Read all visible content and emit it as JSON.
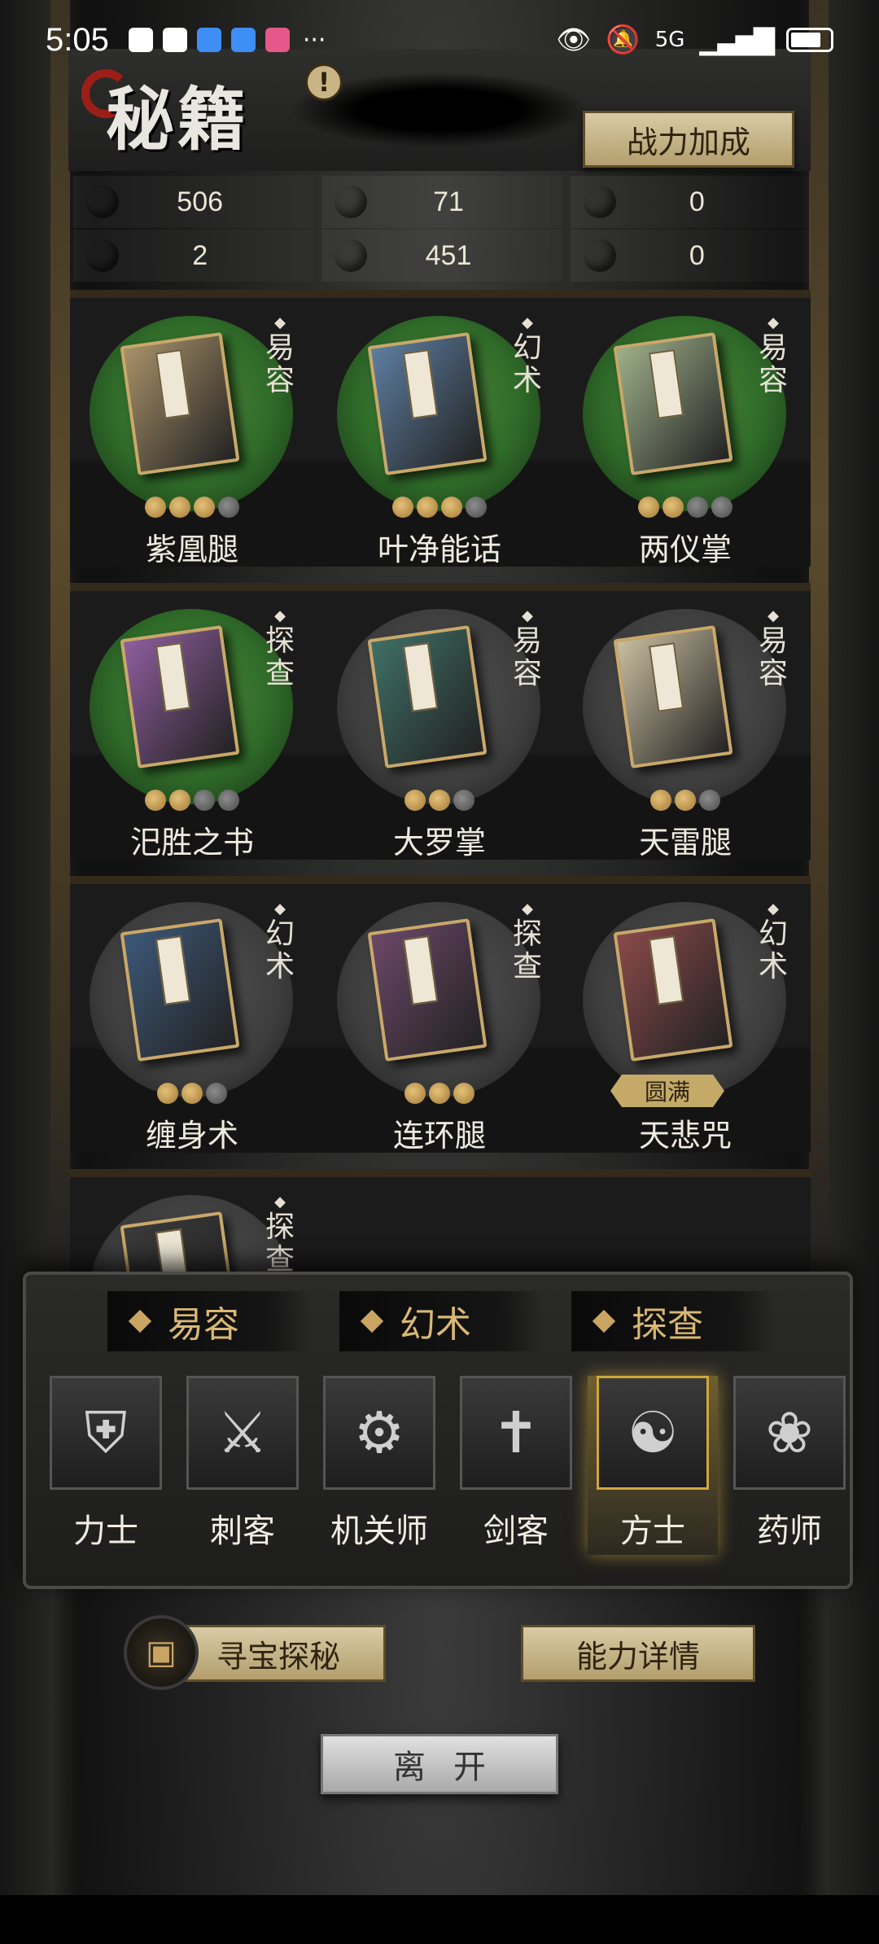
{
  "status_bar": {
    "time": "5:05",
    "dots": "···",
    "network": "5G",
    "icons": [
      "mail-icon",
      "mail-icon",
      "shield-icon",
      "browser-icon",
      "app-icon",
      "eye-icon",
      "bell-off-icon",
      "wifi-icon",
      "signal-icon",
      "battery-icon"
    ]
  },
  "header": {
    "title": "秘籍",
    "alert": "!",
    "power_button": "战力加成"
  },
  "resources": [
    {
      "color": "#4a4a4a",
      "value": "506"
    },
    {
      "color": "#4f9a2a",
      "value": "71"
    },
    {
      "color": "#3e6fa8",
      "value": "0"
    },
    {
      "color": "#6b3a9a",
      "value": "2"
    },
    {
      "color": "#b59a22",
      "value": "451"
    },
    {
      "color": "#b0281e",
      "value": "0"
    }
  ],
  "books": [
    {
      "name": "紫凰腿",
      "type": "易容",
      "bg": "green",
      "cover": "#a8916a",
      "stars": [
        1,
        1,
        1,
        0
      ]
    },
    {
      "name": "叶净能话",
      "type": "幻术",
      "bg": "green",
      "cover": "#5d7ea0",
      "stars": [
        1,
        1,
        1,
        0
      ]
    },
    {
      "name": "两仪掌",
      "type": "易容",
      "bg": "green",
      "cover": "#9eb08a",
      "stars": [
        1,
        1,
        0,
        0
      ]
    },
    {
      "name": "汜胜之书",
      "type": "探查",
      "bg": "green",
      "cover": "#8f5e9e",
      "stars": [
        1,
        1,
        0,
        0
      ]
    },
    {
      "name": "大罗掌",
      "type": "易容",
      "bg": "grey",
      "cover": "#3f6f66",
      "stars": [
        1,
        1,
        0
      ]
    },
    {
      "name": "天雷腿",
      "type": "易容",
      "bg": "grey",
      "cover": "#c9bea0",
      "stars": [
        1,
        1,
        0
      ]
    },
    {
      "name": "缠身术",
      "type": "幻术",
      "bg": "grey",
      "cover": "#3c5878",
      "stars": [
        1,
        1,
        0
      ]
    },
    {
      "name": "连环腿",
      "type": "探查",
      "bg": "grey",
      "cover": "#6b4868",
      "stars": [
        1,
        1,
        1
      ]
    },
    {
      "name": "天悲咒",
      "type": "幻术",
      "bg": "grey",
      "cover": "#8a4a4a",
      "full_label": "圆满"
    },
    {
      "name": "",
      "type": "探查",
      "bg": "grey",
      "cover": "#3a3a3a",
      "stars": []
    }
  ],
  "categories": [
    "易容",
    "幻术",
    "探查"
  ],
  "classes": [
    {
      "label": "力士",
      "glyph": "⛨",
      "icon": "helmet-icon"
    },
    {
      "label": "刺客",
      "glyph": "⚔",
      "icon": "blade-icon"
    },
    {
      "label": "机关师",
      "glyph": "⚙",
      "icon": "gear-icon"
    },
    {
      "label": "剑客",
      "glyph": "✝",
      "icon": "sword-icon"
    },
    {
      "label": "方士",
      "glyph": "☯",
      "icon": "yin-yang-icon",
      "active": true
    },
    {
      "label": "药师",
      "glyph": "❀",
      "icon": "gourd-icon"
    }
  ],
  "bottom": {
    "treasure_button": "寻宝探秘",
    "detail_button": "能力详情",
    "leave_button": "离开"
  }
}
